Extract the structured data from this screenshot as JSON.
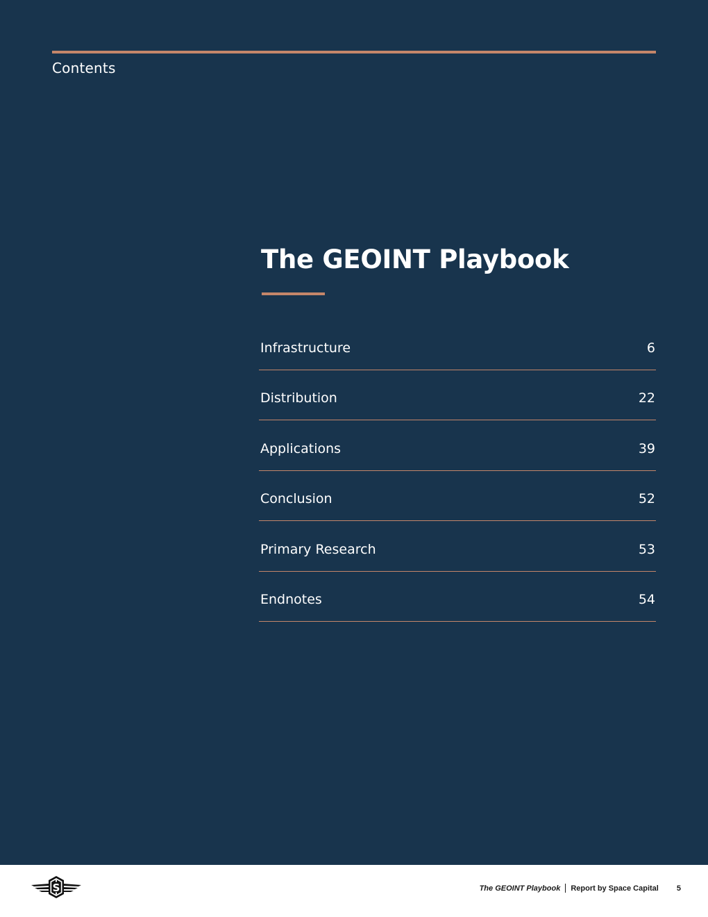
{
  "header": {
    "section_label": "Contents"
  },
  "main": {
    "title": "The GEOINT Playbook",
    "toc": [
      {
        "label": "Infrastructure",
        "page": "6"
      },
      {
        "label": "Distribution",
        "page": "22"
      },
      {
        "label": "Applications",
        "page": "39"
      },
      {
        "label": "Conclusion",
        "page": "52"
      },
      {
        "label": "Primary Research",
        "page": "53"
      },
      {
        "label": "Endnotes",
        "page": "54"
      }
    ]
  },
  "footer": {
    "logo_icon": "winged-s-logo-icon",
    "doc_title": "The GEOINT Playbook",
    "report_by": "Report by Space Capital",
    "page_number": "5"
  },
  "colors": {
    "panel_background": "#18344d",
    "accent": "#c4866a",
    "text_on_dark": "#ffffff",
    "footer_text": "#1a1a1a"
  }
}
